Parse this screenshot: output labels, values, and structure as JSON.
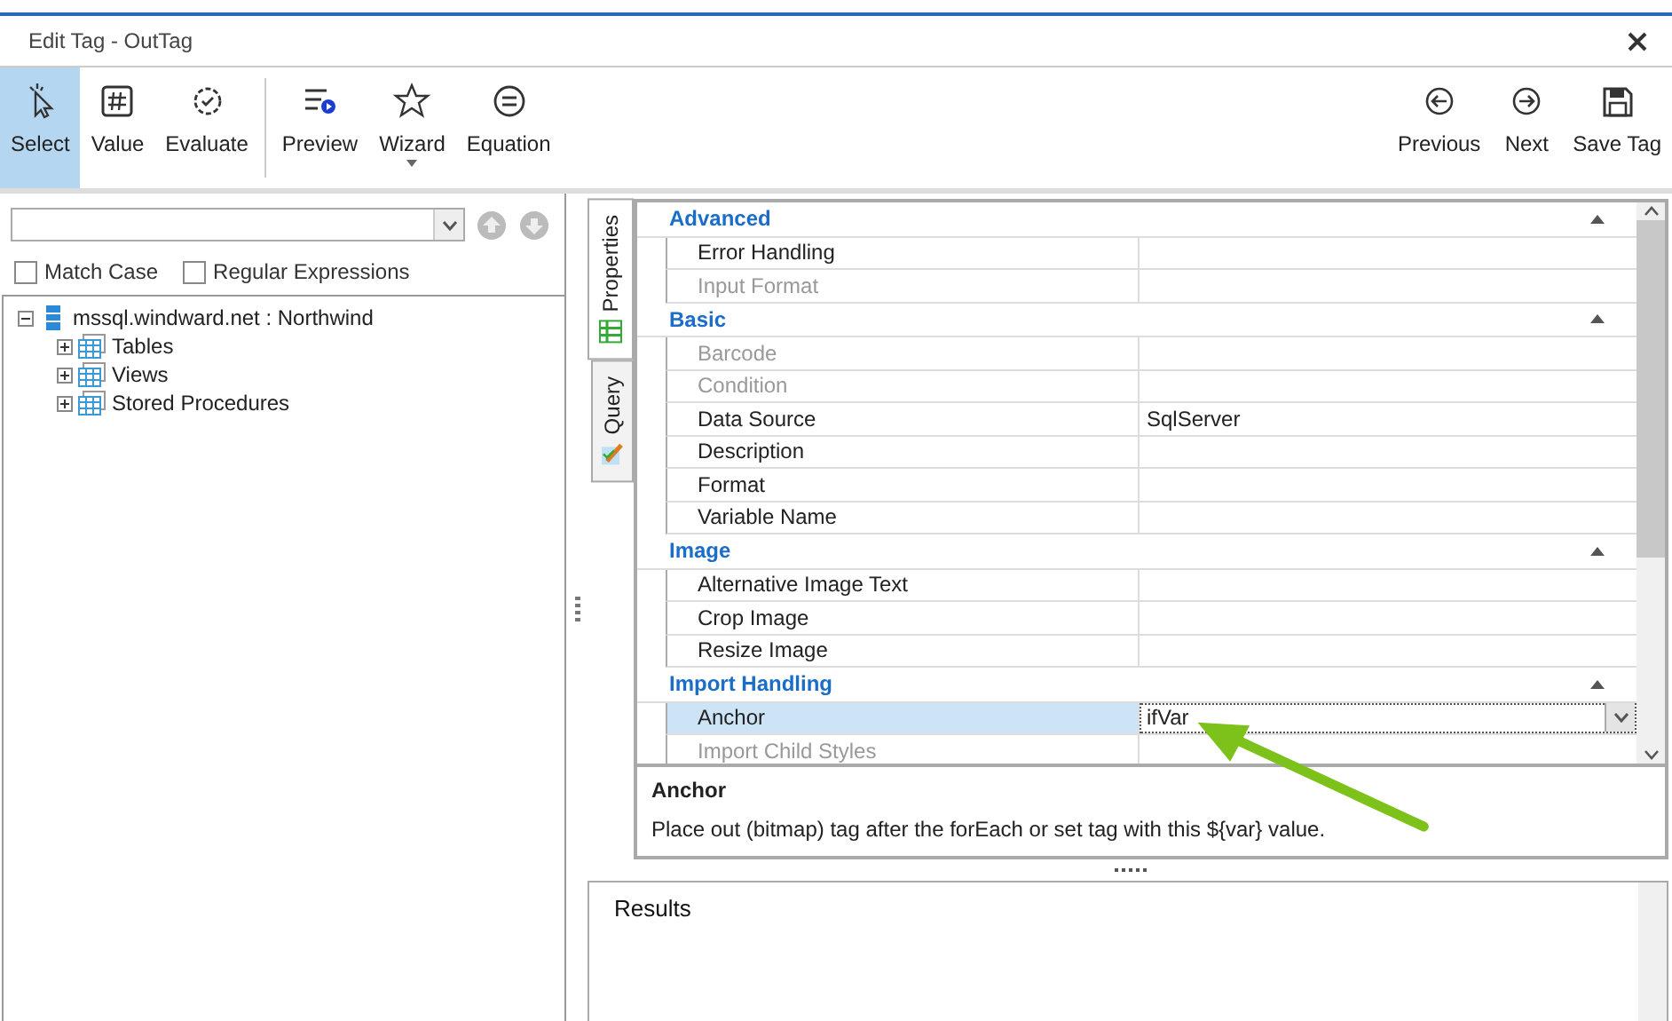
{
  "window": {
    "title": "Edit Tag - OutTag"
  },
  "toolbar": {
    "left": [
      {
        "label": "Select",
        "kind": "select",
        "selected": true,
        "dropdown": false
      },
      {
        "label": "Value",
        "kind": "value",
        "selected": false,
        "dropdown": false
      },
      {
        "label": "Evaluate",
        "kind": "evaluate",
        "selected": false,
        "dropdown": false
      },
      {
        "label": "Preview",
        "kind": "preview",
        "selected": false,
        "dropdown": false
      },
      {
        "label": "Wizard",
        "kind": "wizard",
        "selected": false,
        "dropdown": true
      },
      {
        "label": "Equation",
        "kind": "equation",
        "selected": false,
        "dropdown": false
      }
    ],
    "right": [
      {
        "label": "Previous",
        "kind": "previous",
        "selected": false,
        "dropdown": false
      },
      {
        "label": "Next",
        "kind": "next",
        "selected": false,
        "dropdown": false
      },
      {
        "label": "Save Tag",
        "kind": "save",
        "selected": false,
        "dropdown": false
      }
    ]
  },
  "search": {
    "options": [
      {
        "label": "Match Case",
        "checked": false
      },
      {
        "label": "Regular Expressions",
        "checked": false
      }
    ]
  },
  "tree": [
    {
      "label": "mssql.windward.net : Northwind",
      "kind": "server",
      "expanded": true,
      "children": [
        {
          "label": "Tables",
          "kind": "folder",
          "expanded": false
        },
        {
          "label": "Views",
          "kind": "folder",
          "expanded": false
        },
        {
          "label": "Stored Procedures",
          "kind": "folder",
          "expanded": false
        }
      ]
    }
  ],
  "side_tabs": [
    {
      "label": "Properties",
      "selected": true
    },
    {
      "label": "Query",
      "selected": false
    }
  ],
  "properties": [
    {
      "section": "Advanced",
      "expanded": true,
      "rows": [
        {
          "label": "Error Handling",
          "disabled": false,
          "selected": false
        },
        {
          "label": "Input Format",
          "disabled": true,
          "selected": false
        }
      ]
    },
    {
      "section": "Basic",
      "expanded": true,
      "rows": [
        {
          "label": "Barcode",
          "disabled": true,
          "selected": false
        },
        {
          "label": "Condition",
          "disabled": true,
          "selected": false
        },
        {
          "label": "Data Source",
          "value": "SqlServer",
          "disabled": false,
          "selected": false
        },
        {
          "label": "Description",
          "disabled": false,
          "selected": false
        },
        {
          "label": "Format",
          "disabled": false,
          "selected": false
        },
        {
          "label": "Variable Name",
          "disabled": false,
          "selected": false
        }
      ]
    },
    {
      "section": "Image",
      "expanded": true,
      "rows": [
        {
          "label": "Alternative Image Text",
          "disabled": false,
          "selected": false
        },
        {
          "label": "Crop Image",
          "disabled": false,
          "selected": false
        },
        {
          "label": "Resize Image",
          "disabled": false,
          "selected": false
        }
      ]
    },
    {
      "section": "Import Handling",
      "expanded": true,
      "rows": [
        {
          "label": "Anchor",
          "value": "ifVar",
          "disabled": false,
          "selected": true
        },
        {
          "label": "Import Child Styles",
          "disabled": true,
          "selected": false
        }
      ]
    }
  ],
  "description": {
    "title": "Anchor",
    "text": "Place out (bitmap) tag after the forEach or set tag with this ${var} value."
  },
  "results": {
    "title": "Results"
  }
}
